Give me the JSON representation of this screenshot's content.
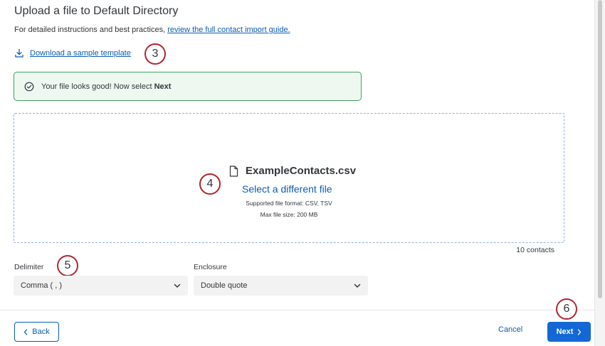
{
  "header": {
    "title": "Upload a file to Default Directory",
    "subtitle_prefix": "For detailed instructions and best practices, ",
    "subtitle_link": "review the full contact import guide."
  },
  "download": {
    "label": "Download a sample template",
    "icon": "download-icon"
  },
  "callouts": {
    "c3": "3",
    "c4": "4",
    "c5": "5",
    "c6": "6"
  },
  "status": {
    "message_prefix": "Your file looks good! Now select ",
    "message_bold": "Next",
    "icon": "check-circle-icon",
    "color": "#3aa55d"
  },
  "upload": {
    "filename": "ExampleContacts.csv",
    "file_icon": "file-icon",
    "select_link": "Select a different file",
    "formats": "Supported file format: CSV, TSV",
    "max_size": "Max file size: 200 MB",
    "count": "10 contacts"
  },
  "options": {
    "delimiter_label": "Delimiter",
    "delimiter_value": "Comma ( , )",
    "enclosure_label": "Enclosure",
    "enclosure_value": "Double quote"
  },
  "footer": {
    "back": "Back",
    "cancel": "Cancel",
    "next": "Next"
  },
  "colors": {
    "accent": "#0b5cb5",
    "primary_button": "#1468d6",
    "callout_ring": "#b0252f"
  }
}
